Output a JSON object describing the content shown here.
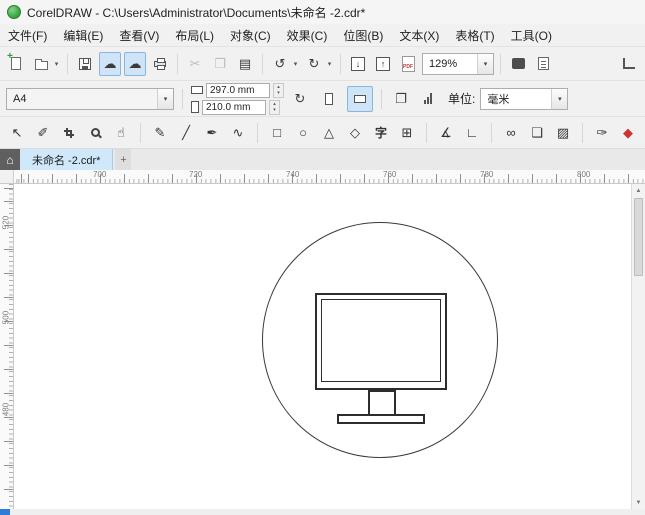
{
  "window": {
    "title": "CorelDRAW - C:\\Users\\Administrator\\Documents\\未命名 -2.cdr*"
  },
  "menu": {
    "items": [
      "文件(F)",
      "编辑(E)",
      "查看(V)",
      "布局(L)",
      "对象(C)",
      "效果(C)",
      "位图(B)",
      "文本(X)",
      "表格(T)",
      "工具(O)"
    ]
  },
  "icons": {
    "dropdown_caret": "▾",
    "cut": "✂",
    "copy": "❐",
    "paste": "▤",
    "undo": "↺",
    "redo": "↻",
    "import_arrow": "↓",
    "export_arrow": "↑",
    "cloud": "☁",
    "swap_arrow": "↻",
    "pages": "❐",
    "home": "⌂",
    "spinner_up": "▴",
    "spinner_down": "▾",
    "scroll_up": "▲",
    "scroll_down": "▼"
  },
  "toolbar": {
    "zoom_value": "129%",
    "pdf_label": "PDF"
  },
  "property_bar": {
    "page_size": "A4",
    "page_width": "297.0 mm",
    "page_height": "210.0 mm",
    "units_label": "单位:",
    "units_value": "毫米"
  },
  "toolbox": {
    "tools": [
      {
        "name": "pick-tool",
        "glyph": "↖"
      },
      {
        "name": "shape-tool",
        "glyph": "✐"
      },
      {
        "name": "crop-tool",
        "glyph": ""
      },
      {
        "name": "zoom-tool",
        "glyph": ""
      },
      {
        "name": "pan-tool",
        "glyph": "☝"
      },
      {
        "name": "freehand-tool",
        "glyph": "✎"
      },
      {
        "name": "two-point-line-tool",
        "glyph": "╱"
      },
      {
        "name": "bezier-tool",
        "glyph": "✒"
      },
      {
        "name": "b-spline-tool",
        "glyph": "∿"
      },
      {
        "name": "rectangle-tool",
        "glyph": "□"
      },
      {
        "name": "ellipse-tool",
        "glyph": "○"
      },
      {
        "name": "polygon-tool",
        "glyph": "△"
      },
      {
        "name": "common-shapes-tool",
        "glyph": "◇"
      },
      {
        "name": "text-tool",
        "glyph": "字"
      },
      {
        "name": "table-tool",
        "glyph": "⊞"
      },
      {
        "name": "dimension-tool",
        "glyph": "∡"
      },
      {
        "name": "connector-tool",
        "glyph": "∟"
      },
      {
        "name": "blend-tool",
        "glyph": "∞"
      },
      {
        "name": "contour-tool",
        "glyph": "❏"
      },
      {
        "name": "transparency-tool",
        "glyph": "▨"
      },
      {
        "name": "eyedropper-tool",
        "glyph": "✑"
      },
      {
        "name": "interactive-fill-tool",
        "glyph": "◆"
      }
    ]
  },
  "tabs": {
    "active": "未命名 -2.cdr*",
    "new_tab": "+"
  },
  "rulers": {
    "horizontal": [
      "700",
      "720",
      "740",
      "760",
      "780",
      "800"
    ],
    "vertical": [
      "520",
      "500",
      "480"
    ]
  },
  "canvas": {
    "objects": [
      "circle-outline",
      "computer-monitor-pictogram"
    ]
  },
  "colors": {
    "pressed_blue": "#cfe5f7",
    "tab_blue": "#cfe9fb",
    "fill_tool_red": "#cc3333",
    "logo_green": "#3fae49",
    "status_accent": "#2e7cd6"
  }
}
